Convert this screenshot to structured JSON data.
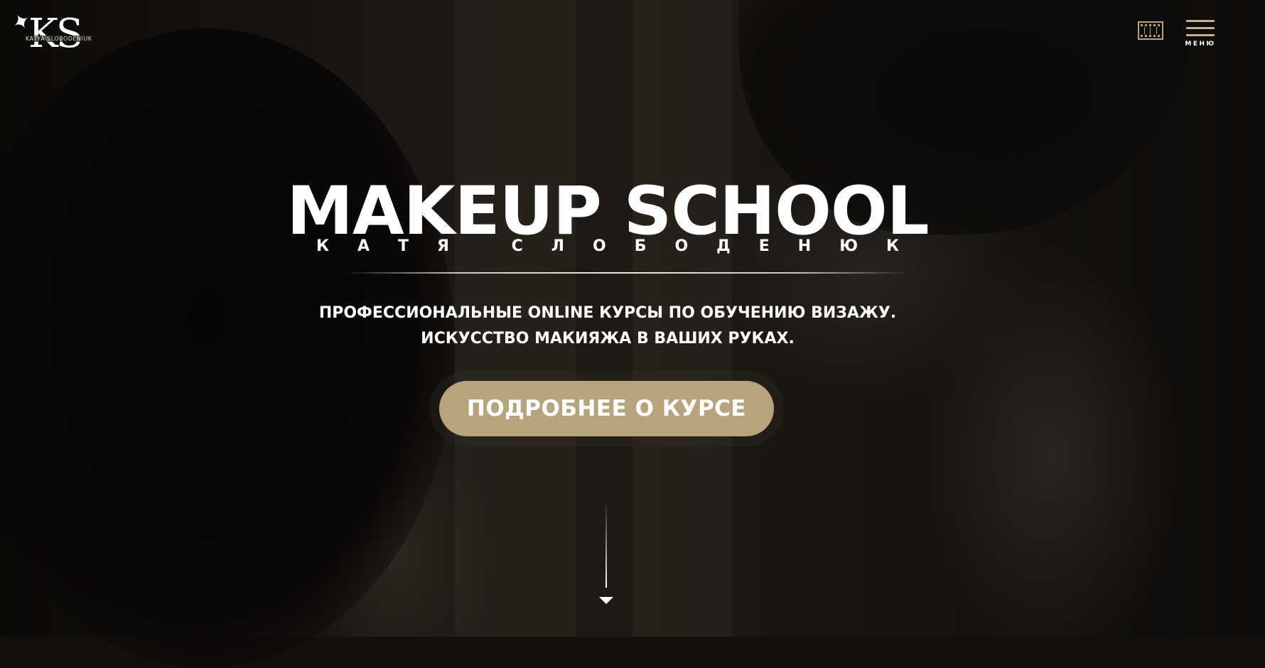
{
  "header": {
    "logo_letters": "KS",
    "logo_caption": "KATYA SLOBODENIUK",
    "menu_label": "МЕНЮ"
  },
  "hero": {
    "title": "MAKEUP SCHOOL",
    "subtitle": "КАТЯ СЛОБОДЕНЮК",
    "tagline_line1": "ПРОФЕССИОНАЛЬНЫЕ ONLINE КУРСЫ ПО ОБУЧЕНИЮ ВИЗАЖУ.",
    "tagline_line2": "ИСКУССТВО МАКИЯЖА В ВАШИХ РУКАХ.",
    "cta_label": "ПОДРОБНЕЕ О КУРСЕ"
  },
  "icons": {
    "brand_icon": "brush-icon",
    "video_icon": "film-icon",
    "menu_icon": "hamburger-menu-icon",
    "scroll_icon": "arrow-down-icon"
  },
  "colors": {
    "accent": "#b8a47c",
    "menu_bars": "#c4b08a",
    "background": "#120f0c",
    "text": "#ffffff"
  }
}
